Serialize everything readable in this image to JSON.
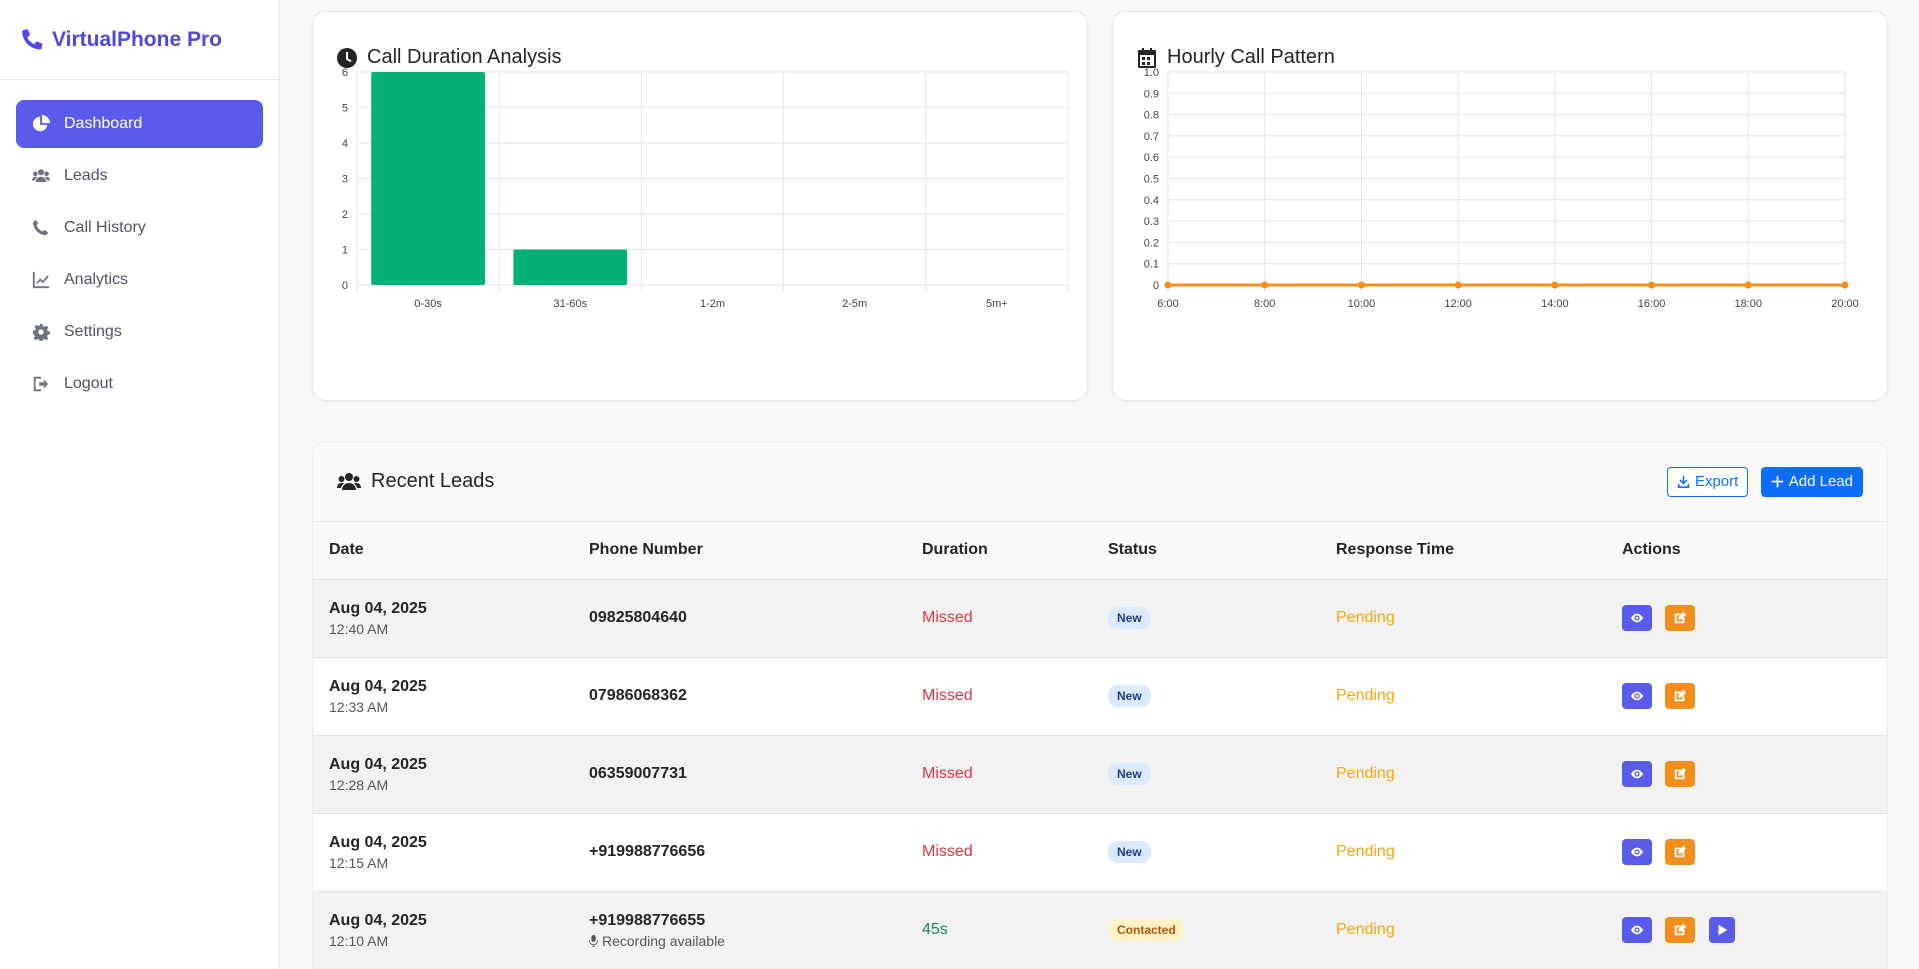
{
  "app": {
    "brand": "VirtualPhone Pro"
  },
  "sidebar": {
    "items": [
      {
        "label": "Dashboard",
        "icon": "chart-pie-icon",
        "active": true
      },
      {
        "label": "Leads",
        "icon": "users-icon"
      },
      {
        "label": "Call History",
        "icon": "phone-icon"
      },
      {
        "label": "Analytics",
        "icon": "line-chart-icon"
      },
      {
        "label": "Settings",
        "icon": "gear-icon"
      },
      {
        "label": "Logout",
        "icon": "logout-icon"
      }
    ]
  },
  "duration_card": {
    "title": "Call Duration Analysis"
  },
  "hourly_card": {
    "title": "Hourly Call Pattern"
  },
  "chart_data": [
    {
      "type": "bar",
      "title": "Call Duration Analysis",
      "categories": [
        "0-30s",
        "31-60s",
        "1-2m",
        "2-5m",
        "5m+"
      ],
      "values": [
        6,
        1,
        0,
        0,
        0
      ],
      "ylim": [
        0,
        6
      ],
      "yticks": [
        0,
        1,
        2,
        3,
        4,
        5,
        6
      ],
      "color": "#05b076",
      "grid": true
    },
    {
      "type": "line",
      "title": "Hourly Call Pattern",
      "x": [
        "6:00",
        "8:00",
        "10:00",
        "12:00",
        "14:00",
        "16:00",
        "18:00",
        "20:00"
      ],
      "values": [
        0,
        0,
        0,
        0,
        0,
        0,
        0,
        0
      ],
      "ylim": [
        0,
        1
      ],
      "yticks": [
        "0",
        "0.1",
        "0.2",
        "0.3",
        "0.4",
        "0.5",
        "0.6",
        "0.7",
        "0.8",
        "0.9",
        "1.0"
      ],
      "color": "#f18e1c",
      "grid": true
    }
  ],
  "leads": {
    "title": "Recent Leads",
    "export_label": "Export",
    "add_label": "Add Lead",
    "columns": [
      "Date",
      "Phone Number",
      "Duration",
      "Status",
      "Response Time",
      "Actions"
    ],
    "rows": [
      {
        "date": "Aug 04, 2025",
        "time": "12:40 AM",
        "phone": "09825804640",
        "duration": "Missed",
        "status": "New",
        "response": "Pending"
      },
      {
        "date": "Aug 04, 2025",
        "time": "12:33 AM",
        "phone": "07986068362",
        "duration": "Missed",
        "status": "New",
        "response": "Pending"
      },
      {
        "date": "Aug 04, 2025",
        "time": "12:28 AM",
        "phone": "06359007731",
        "duration": "Missed",
        "status": "New",
        "response": "Pending"
      },
      {
        "date": "Aug 04, 2025",
        "time": "12:15 AM",
        "phone": "+919988776656",
        "duration": "Missed",
        "status": "New",
        "response": "Pending"
      },
      {
        "date": "Aug 04, 2025",
        "time": "12:10 AM",
        "phone": "+919988776655",
        "recording": "Recording available",
        "duration": "45s",
        "status": "Contacted",
        "response": "Pending"
      }
    ]
  }
}
